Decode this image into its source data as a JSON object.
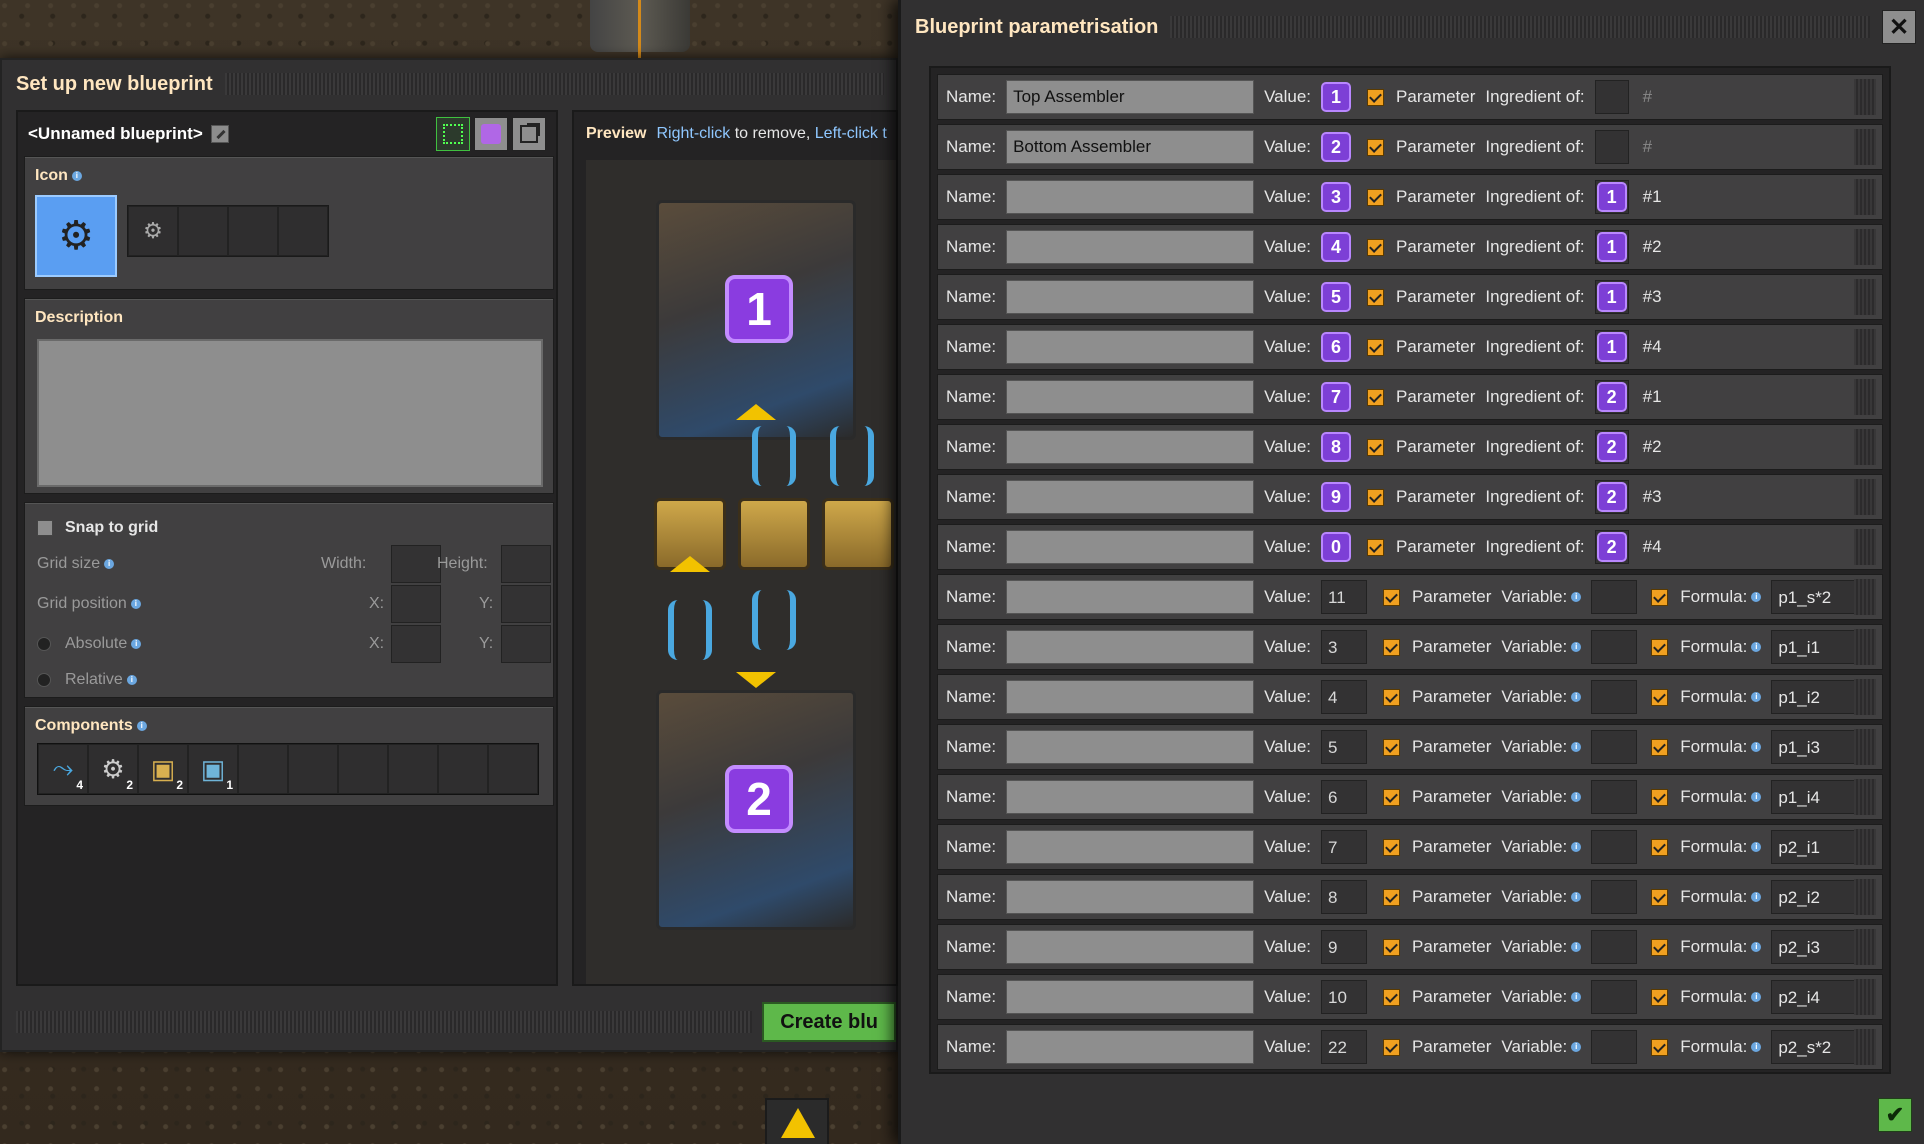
{
  "left_window": {
    "title": "Set up new blueprint",
    "blueprint_name": "<Unnamed blueprint>",
    "icon_label": "Icon",
    "description_label": "Description",
    "snap_label": "Snap to grid",
    "grid_size_label": "Grid size",
    "width_label": "Width:",
    "height_label": "Height:",
    "grid_position_label": "Grid position",
    "x_label": "X:",
    "y_label": "Y:",
    "absolute_label": "Absolute",
    "relative_label": "Relative",
    "components_label": "Components",
    "components": [
      {
        "icon": "inserter-icon",
        "count": "4"
      },
      {
        "icon": "assembler-icon",
        "count": "2"
      },
      {
        "icon": "chest-icon",
        "count": "2"
      },
      {
        "icon": "blue-chest-icon",
        "count": "1"
      }
    ],
    "preview": {
      "label": "Preview",
      "hint_right": "Right-click",
      "hint_mid": " to remove, ",
      "hint_left": "Left-click t"
    },
    "assembler_1": "1",
    "assembler_2": "2",
    "create_button": "Create blu"
  },
  "right_window": {
    "title": "Blueprint parametrisation",
    "name_label": "Name:",
    "value_label": "Value:",
    "parameter_label": "Parameter",
    "ingredient_label": "Ingredient of:",
    "variable_label": "Variable:",
    "formula_label": "Formula:",
    "rows": [
      {
        "name": "Top Assembler",
        "value": "1",
        "ingredient": "",
        "hash": "#"
      },
      {
        "name": "Bottom Assembler",
        "value": "2",
        "ingredient": "",
        "hash": "#"
      },
      {
        "name": "",
        "value": "3",
        "ingredient": "1",
        "hash": "#1"
      },
      {
        "name": "",
        "value": "4",
        "ingredient": "1",
        "hash": "#2"
      },
      {
        "name": "",
        "value": "5",
        "ingredient": "1",
        "hash": "#3"
      },
      {
        "name": "",
        "value": "6",
        "ingredient": "1",
        "hash": "#4"
      },
      {
        "name": "",
        "value": "7",
        "ingredient": "2",
        "hash": "#1"
      },
      {
        "name": "",
        "value": "8",
        "ingredient": "2",
        "hash": "#2"
      },
      {
        "name": "",
        "value": "9",
        "ingredient": "2",
        "hash": "#3"
      },
      {
        "name": "",
        "value": "0",
        "ingredient": "2",
        "hash": "#4"
      }
    ],
    "formula_rows": [
      {
        "name": "",
        "value": "11",
        "formula": "p1_s*2"
      },
      {
        "name": "",
        "value": "3",
        "formula": "p1_i1"
      },
      {
        "name": "",
        "value": "4",
        "formula": "p1_i2"
      },
      {
        "name": "",
        "value": "5",
        "formula": "p1_i3"
      },
      {
        "name": "",
        "value": "6",
        "formula": "p1_i4"
      },
      {
        "name": "",
        "value": "7",
        "formula": "p2_i1"
      },
      {
        "name": "",
        "value": "8",
        "formula": "p2_i2"
      },
      {
        "name": "",
        "value": "9",
        "formula": "p2_i3"
      },
      {
        "name": "",
        "value": "10",
        "formula": "p2_i4"
      },
      {
        "name": "",
        "value": "22",
        "formula": "p2_s*2"
      }
    ]
  },
  "colors": {
    "accent_purple": "#7d3fd6",
    "checkbox_orange": "#f0a020",
    "confirm_green": "#5eb84a",
    "title_text": "#ffe6c0",
    "link_blue": "#8fc7ff"
  }
}
